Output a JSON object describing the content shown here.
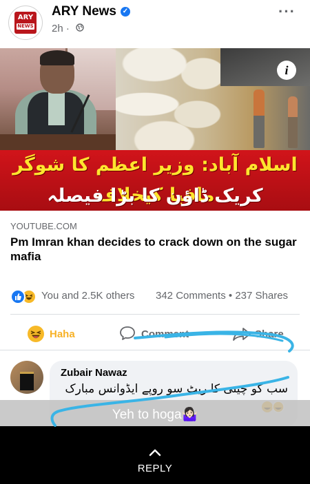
{
  "post": {
    "page_name": "ARY News",
    "verified_icon": "verified-badge-icon",
    "time": "2h",
    "visibility_icon": "globe-icon",
    "more_icon": "more-dots-icon",
    "logo_text_top": "ARY",
    "logo_text_bottom": "NEWS"
  },
  "media": {
    "headline_line1": "اسلام آباد: وزیر اعظم کا شوگر مافیا کیخلاف",
    "headline_line2": "کریک ڈاؤن کا بڑا فیصلہ",
    "info_icon": "i"
  },
  "link": {
    "domain": "YOUTUBE.COM",
    "title": "Pm Imran khan decides to crack down on the sugar mafia"
  },
  "reactions": {
    "summary": "You and 2.5K others",
    "comments": "342 Comments",
    "separator": "•",
    "shares": "237 Shares"
  },
  "actions": {
    "haha_label": "Haha",
    "comment_label": "Comment",
    "share_label": "Share"
  },
  "comment": {
    "author": "Zubair Nawaz",
    "text": "سب کو چینی کا ریٹ سو روپے ایڈوانس مبارک"
  },
  "story_reply": {
    "caption": "Yeh to hoga🤷🏻‍♀️",
    "reply_label": "REPLY"
  },
  "colors": {
    "accent": "#1877f2",
    "haha": "#f7b928",
    "doodle": "#3ab4e6",
    "banner_red": "#c4121a",
    "headline_yellow": "#ffe52e"
  }
}
